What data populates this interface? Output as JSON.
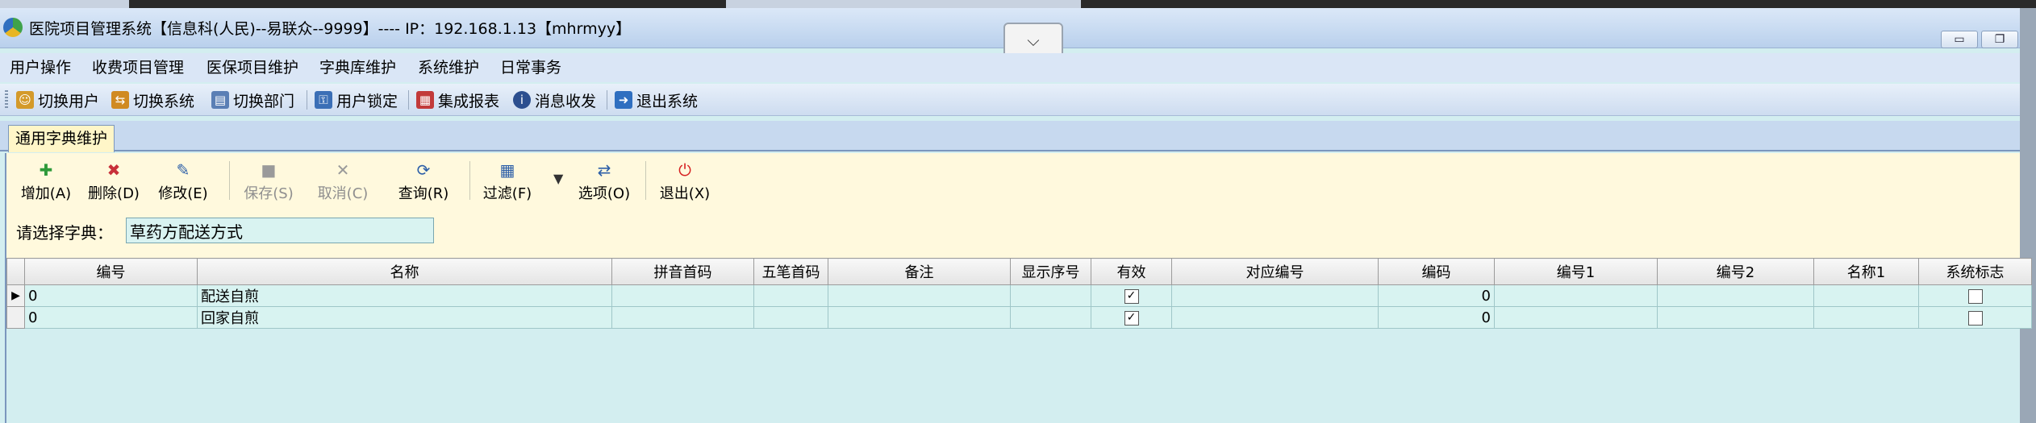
{
  "window": {
    "title": "医院项目管理系统【信息科(人民)--易联众--9999】---- IP：192.168.1.13【mhrmyy】",
    "collapse_glyph": "⌵"
  },
  "window_controls": {
    "minimize": "▭",
    "restore": "❐",
    "close": "✕"
  },
  "menubar": [
    "用户操作",
    "收费项目管理",
    "医保项目维护",
    "字典库维护",
    "系统维护",
    "日常事务"
  ],
  "quickbar": [
    {
      "label": "切换用户",
      "icon": "users-icon",
      "color": "#d49a2a"
    },
    {
      "label": "切换系统",
      "icon": "switch-system-icon",
      "color": "#d08a22"
    },
    {
      "label": "切换部门",
      "icon": "department-icon",
      "color": "#5a7fb5"
    },
    {
      "label": "用户锁定",
      "icon": "user-lock-icon",
      "color": "#3b6fb6"
    },
    {
      "label": "集成报表",
      "icon": "report-icon",
      "color": "#c23a3a"
    },
    {
      "label": "消息收发",
      "icon": "info-icon",
      "color": "#2c4f8f"
    },
    {
      "label": "退出系统",
      "icon": "exit-icon",
      "color": "#2f6fc0"
    }
  ],
  "tab": {
    "label": "通用字典维护"
  },
  "toolbar": [
    {
      "label": "增加(A)",
      "icon": "add-icon",
      "glyph": "✚",
      "color": "#2e9a3a",
      "enabled": true
    },
    {
      "label": "删除(D)",
      "icon": "delete-icon",
      "glyph": "✖",
      "color": "#c8303a",
      "enabled": true
    },
    {
      "label": "修改(E)",
      "icon": "edit-icon",
      "glyph": "✎",
      "color": "#2d5fa8",
      "enabled": true
    },
    {
      "label": "保存(S)",
      "icon": "save-icon",
      "glyph": "■",
      "color": "#9a9a9a",
      "enabled": false
    },
    {
      "label": "取消(C)",
      "icon": "cancel-icon",
      "glyph": "✕",
      "color": "#9a9a9a",
      "enabled": false
    },
    {
      "label": "查询(R)",
      "icon": "query-icon",
      "glyph": "⟳",
      "color": "#2d5fa8",
      "enabled": true
    },
    {
      "label": "过滤(F)",
      "icon": "filter-icon",
      "glyph": "▦",
      "color": "#2d5fa8",
      "enabled": true
    },
    {
      "label": "选项(O)",
      "icon": "options-icon",
      "glyph": "⇄",
      "color": "#2d5fa8",
      "enabled": true
    },
    {
      "label": "退出(X)",
      "icon": "power-icon",
      "glyph": "⏻",
      "color": "#d62020",
      "enabled": true
    }
  ],
  "dict": {
    "label": "请选择字典：",
    "value": "草药方配送方式"
  },
  "grid": {
    "columns": [
      "编号",
      "名称",
      "拼音首码",
      "五笔首码",
      "备注",
      "显示序号",
      "有效",
      "对应编号",
      "编码",
      "编号1",
      "编号2",
      "名称1",
      "系统标志"
    ],
    "rows": [
      {
        "indicator": "▶",
        "cells": [
          "0",
          "配送自煎",
          "",
          "",
          "",
          "",
          "✓",
          "",
          "0",
          "",
          "",
          "",
          ""
        ]
      },
      {
        "indicator": "",
        "cells": [
          "0",
          "回家自煎",
          "",
          "",
          "",
          "",
          "✓",
          "",
          "0",
          "",
          "",
          "",
          ""
        ]
      }
    ]
  }
}
